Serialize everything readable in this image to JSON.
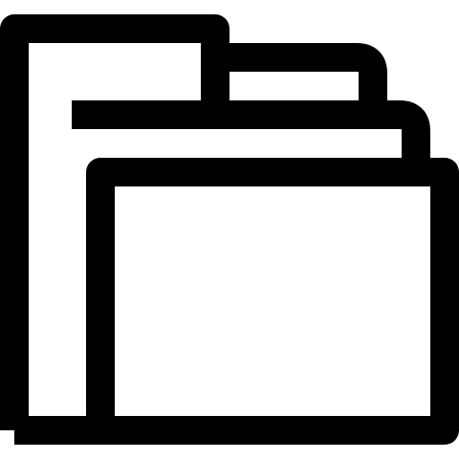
{
  "icon": {
    "semantic_name": "folder-icon",
    "style": "outline",
    "colors": {
      "stroke": "#000000",
      "background": "#ffffff"
    }
  }
}
